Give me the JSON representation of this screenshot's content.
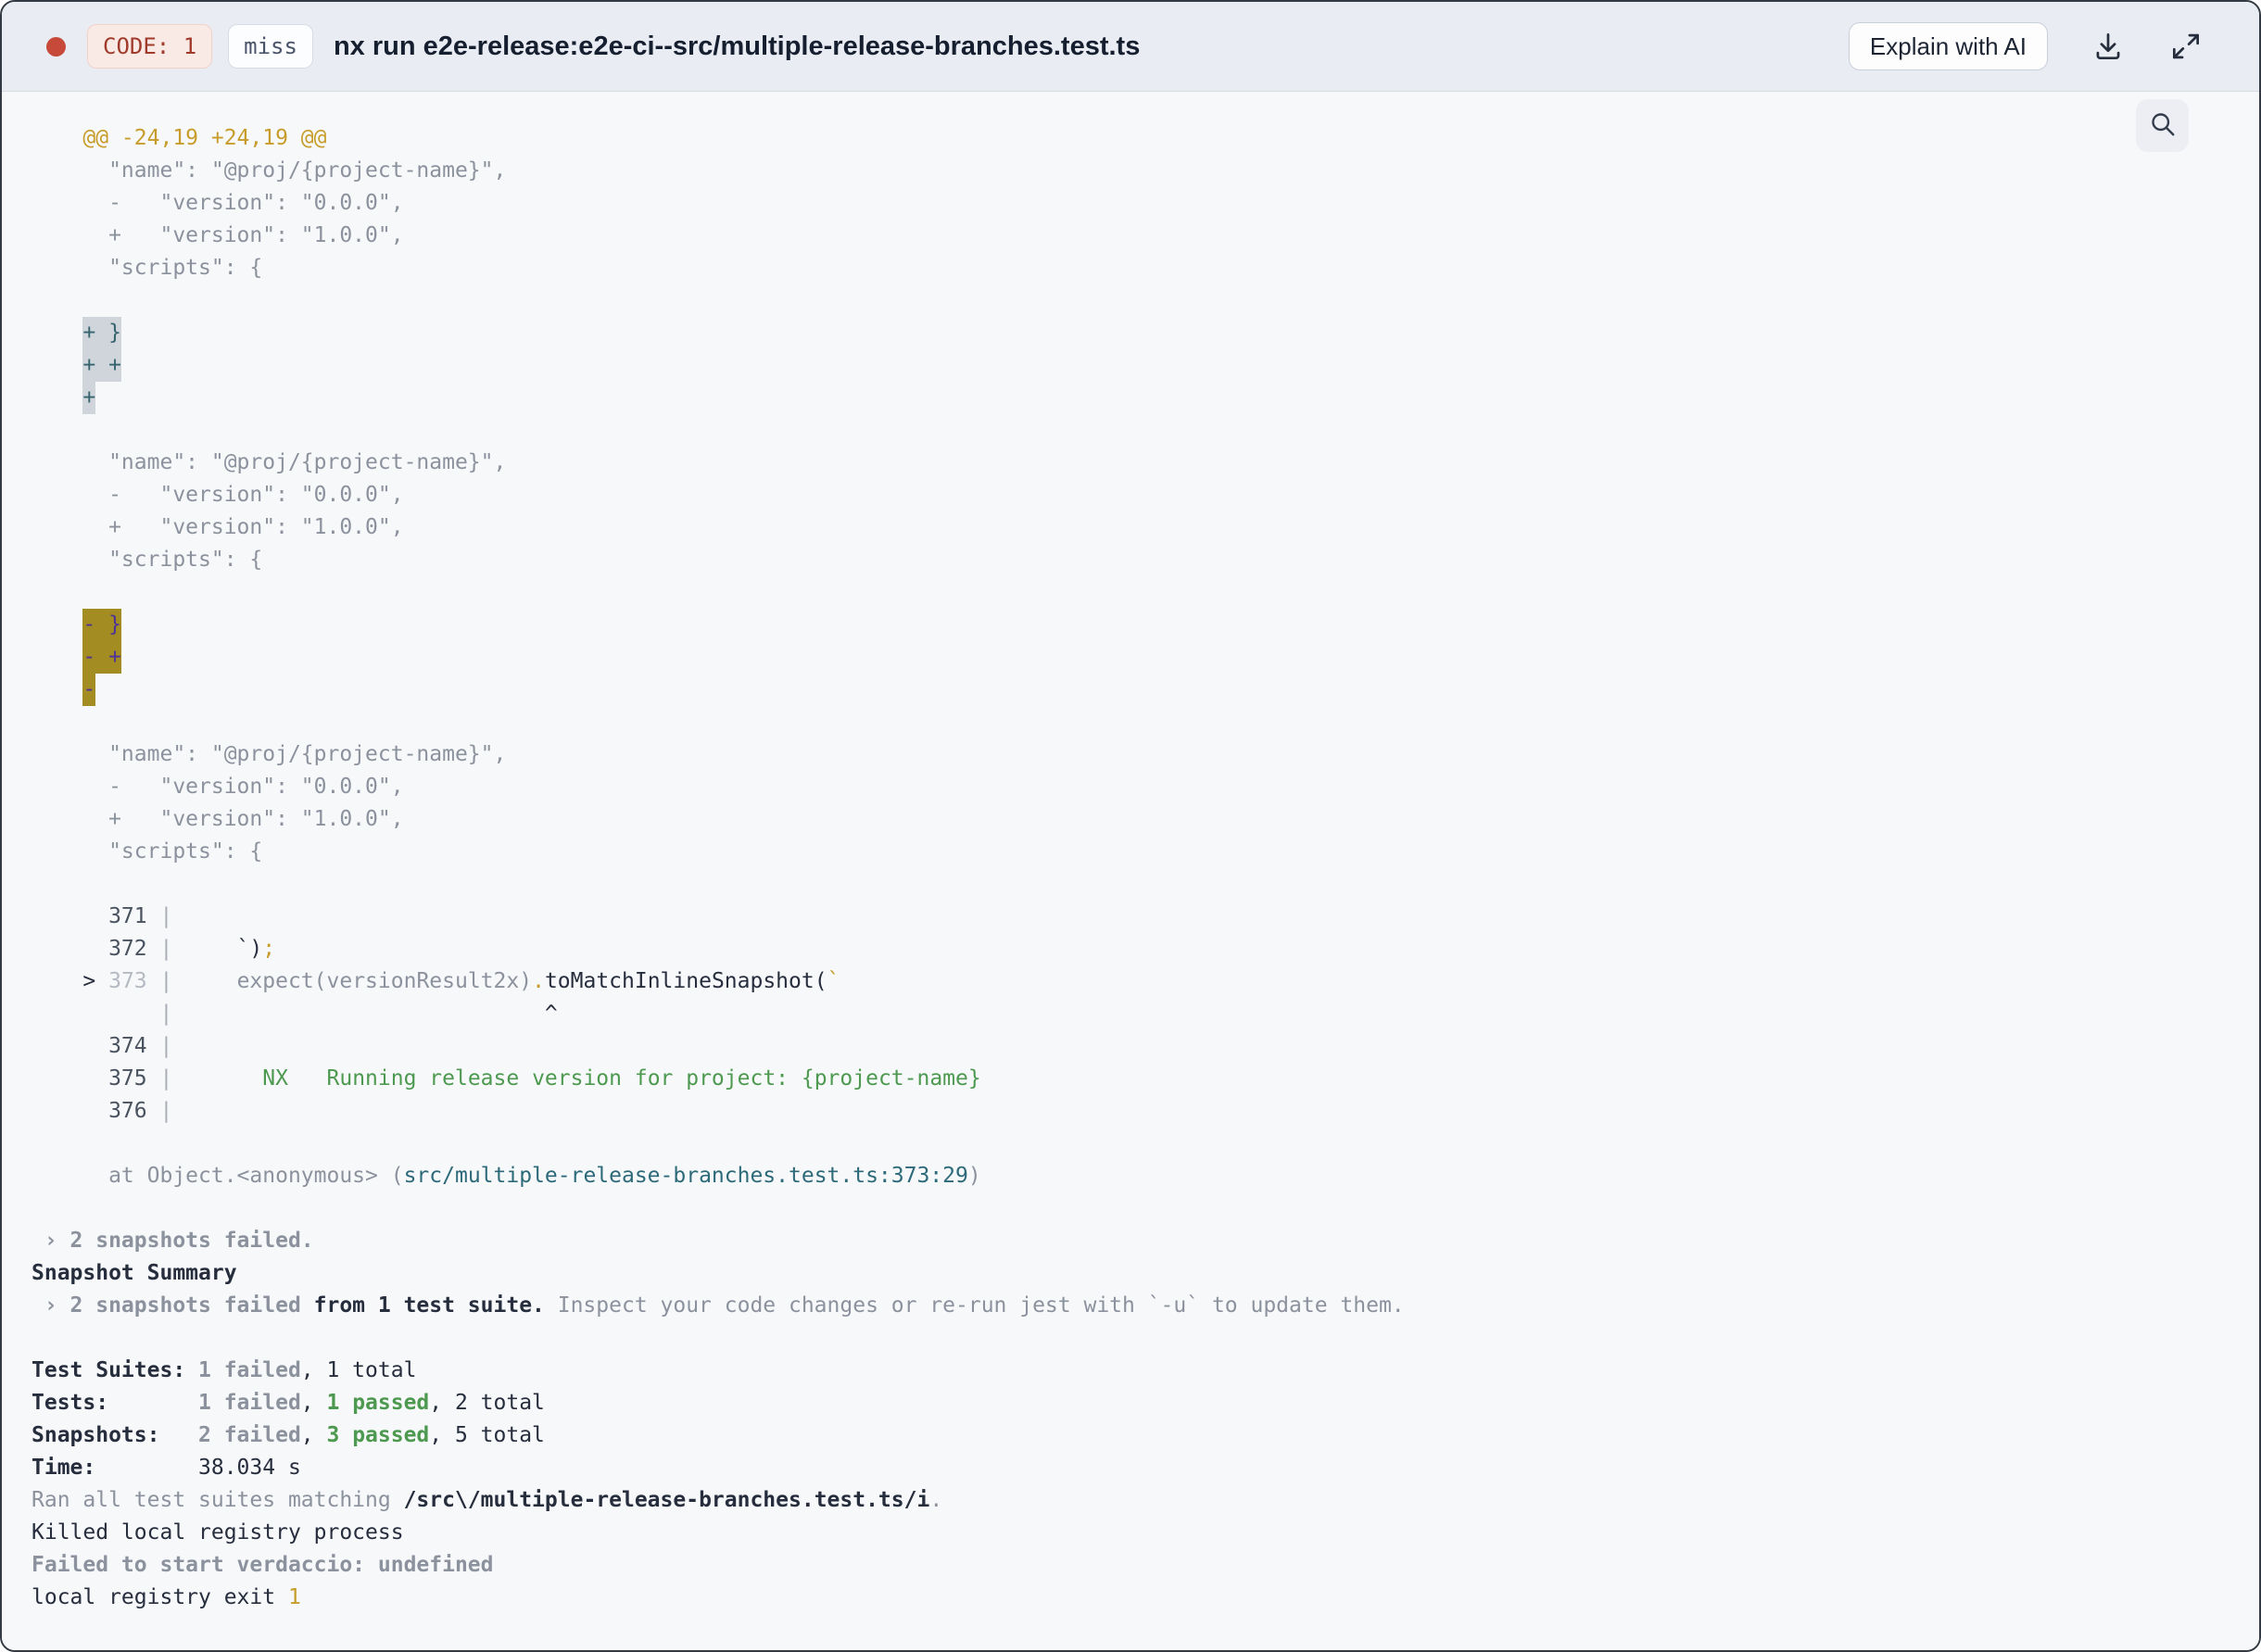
{
  "header": {
    "exit_code_label": "CODE: 1",
    "cache_status": "miss",
    "title": "nx run e2e-release:e2e-ci--src/multiple-release-branches.test.ts",
    "explain_button": "Explain with AI"
  },
  "icons": [
    "status-dot",
    "download-icon",
    "expand-icon",
    "search-icon"
  ],
  "colors": {
    "status_dot": "#c7493a",
    "exit_code_text": "#a03b2c",
    "header_bg": "#e9ecf2",
    "content_bg": "#f7f8fa",
    "diff_hunk_yellow": "#c79c2a",
    "pass_green": "#4d9950",
    "file_link_teal": "#2c6979",
    "added_highlight_bg": "#d0d5db",
    "added_highlight_text": "#35646f",
    "removed_highlight_bg": "#a38c21",
    "removed_highlight_text": "#4e3498"
  },
  "terminal": {
    "lines": [
      [
        [
          "y",
          "    @@ -24,19 +24,19 @@"
        ]
      ],
      [
        [
          "g",
          "      \"name\": \"@proj/{project-name}\","
        ]
      ],
      [
        [
          "g",
          "      -   \"version\": \"0.0.0\","
        ]
      ],
      [
        [
          "g",
          "      +   \"version\": \"1.0.0\","
        ]
      ],
      [
        [
          "g",
          "      \"scripts\": {"
        ]
      ],
      [],
      [
        [
          "g",
          "    "
        ],
        [
          "ha",
          "+ }"
        ]
      ],
      [
        [
          "g",
          "    "
        ],
        [
          "ha",
          "+ +"
        ]
      ],
      [
        [
          "g",
          "    "
        ],
        [
          "ha",
          "+"
        ]
      ],
      [],
      [
        [
          "g",
          "      \"name\": \"@proj/{project-name}\","
        ]
      ],
      [
        [
          "g",
          "      -   \"version\": \"0.0.0\","
        ]
      ],
      [
        [
          "g",
          "      +   \"version\": \"1.0.0\","
        ]
      ],
      [
        [
          "g",
          "      \"scripts\": {"
        ]
      ],
      [],
      [
        [
          "g",
          "    "
        ],
        [
          "hd",
          "- }"
        ]
      ],
      [
        [
          "g",
          "    "
        ],
        [
          "hd",
          "- +"
        ]
      ],
      [
        [
          "g",
          "    "
        ],
        [
          "hd",
          "-"
        ]
      ],
      [],
      [
        [
          "g",
          "      \"name\": \"@proj/{project-name}\","
        ]
      ],
      [
        [
          "g",
          "      -   \"version\": \"0.0.0\","
        ]
      ],
      [
        [
          "g",
          "      +   \"version\": \"1.0.0\","
        ]
      ],
      [
        [
          "g",
          "      \"scripts\": {"
        ]
      ],
      [],
      [
        [
          "n",
          "      371 "
        ],
        [
          "p",
          "|"
        ]
      ],
      [
        [
          "n",
          "      372 "
        ],
        [
          "p",
          "|"
        ],
        [
          "d",
          "     `)"
        ],
        [
          "y",
          ";"
        ]
      ],
      [
        [
          "d",
          "    > "
        ],
        [
          "ln",
          "373 "
        ],
        [
          "p",
          "|"
        ],
        [
          "g",
          "     expect(versionResult2x)"
        ],
        [
          "y",
          "."
        ],
        [
          "d",
          "toMatchInlineSnapshot("
        ],
        [
          "y",
          "`"
        ]
      ],
      [
        [
          "p",
          "          |"
        ],
        [
          "d",
          "                             ^"
        ]
      ],
      [
        [
          "n",
          "      374 "
        ],
        [
          "p",
          "|"
        ]
      ],
      [
        [
          "n",
          "      375 "
        ],
        [
          "p",
          "|"
        ],
        [
          "gr",
          "       NX   Running release version for project: {project-name}"
        ]
      ],
      [
        [
          "n",
          "      376 "
        ],
        [
          "p",
          "|"
        ]
      ],
      [],
      [
        [
          "g",
          "      at Object.<anonymous> ("
        ],
        [
          "tp",
          "src/multiple-release-branches.test.ts:373:29"
        ],
        [
          "g",
          ")"
        ]
      ],
      [],
      [
        [
          "gb",
          " › 2 snapshots failed."
        ]
      ],
      [
        [
          "db",
          "Snapshot Summary"
        ]
      ],
      [
        [
          "gb",
          " › 2 snapshots failed "
        ],
        [
          "db",
          "from 1 test suite."
        ],
        [
          "g",
          " Inspect your code changes or re-run jest with `-u` to update them."
        ]
      ],
      [],
      [
        [
          "db",
          "Test Suites: "
        ],
        [
          "gb",
          "1 failed"
        ],
        [
          "d",
          ", 1 total"
        ]
      ],
      [
        [
          "db",
          "Tests:       "
        ],
        [
          "gb",
          "1 failed"
        ],
        [
          "d",
          ", "
        ],
        [
          "grb",
          "1 passed"
        ],
        [
          "d",
          ", 2 total"
        ]
      ],
      [
        [
          "db",
          "Snapshots:   "
        ],
        [
          "gb",
          "2 failed"
        ],
        [
          "d",
          ", "
        ],
        [
          "grb",
          "3 passed"
        ],
        [
          "d",
          ", 5 total"
        ]
      ],
      [
        [
          "db",
          "Time:        "
        ],
        [
          "d",
          "38.034 s"
        ]
      ],
      [
        [
          "g",
          "Ran all test suites matching "
        ],
        [
          "db",
          "/src\\/multiple-release-branches.test.ts/i"
        ],
        [
          "g",
          "."
        ]
      ],
      [
        [
          "d",
          "Killed local registry process"
        ]
      ],
      [
        [
          "gb",
          "Failed to start verdaccio: undefined"
        ]
      ],
      [
        [
          "d",
          "local registry exit "
        ],
        [
          "y",
          "1"
        ]
      ]
    ]
  }
}
